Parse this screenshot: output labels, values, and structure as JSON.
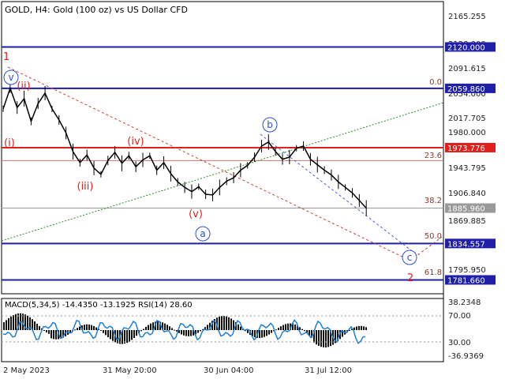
{
  "chart_data": [
    {
      "type": "line",
      "title": "GOLD, H4:  Gold (100 oz) vs US Dollar CFD",
      "y_range": [
        1760,
        2190
      ],
      "price_axis_ticks": [
        "2165.255",
        "2128.000",
        "2091.615",
        "2054.000",
        "2017.705",
        "1980.000",
        "1943.795",
        "1906.840",
        "1869.885",
        "1795.950"
      ],
      "x_ticks": [
        "2 May 2023",
        "31 May 20:00",
        "30 Jun 04:00",
        "31 Jul 12:00"
      ],
      "price_series_approx": [
        [
          0,
          2030
        ],
        [
          3,
          2060
        ],
        [
          6,
          2032
        ],
        [
          9,
          2045
        ],
        [
          12,
          2012
        ],
        [
          15,
          2038
        ],
        [
          18,
          2053
        ],
        [
          21,
          2030
        ],
        [
          24,
          2014
        ],
        [
          27,
          1995
        ],
        [
          30,
          1968
        ],
        [
          33,
          1952
        ],
        [
          36,
          1963
        ],
        [
          39,
          1944
        ],
        [
          42,
          1935
        ],
        [
          45,
          1955
        ],
        [
          48,
          1967
        ],
        [
          51,
          1951
        ],
        [
          54,
          1962
        ],
        [
          57,
          1946
        ],
        [
          60,
          1956
        ],
        [
          63,
          1962
        ],
        [
          66,
          1941
        ],
        [
          69,
          1952
        ],
        [
          72,
          1936
        ],
        [
          75,
          1924
        ],
        [
          78,
          1916
        ],
        [
          81,
          1910
        ],
        [
          84,
          1917
        ],
        [
          87,
          1906
        ],
        [
          90,
          1905
        ],
        [
          93,
          1916
        ],
        [
          96,
          1925
        ],
        [
          99,
          1930
        ],
        [
          102,
          1941
        ],
        [
          105,
          1948
        ],
        [
          108,
          1960
        ],
        [
          111,
          1976
        ],
        [
          114,
          1982
        ],
        [
          117,
          1968
        ],
        [
          120,
          1957
        ],
        [
          123,
          1960
        ],
        [
          126,
          1973
        ],
        [
          129,
          1976
        ],
        [
          132,
          1957
        ],
        [
          135,
          1949
        ],
        [
          138,
          1941
        ],
        [
          141,
          1934
        ],
        [
          144,
          1924
        ],
        [
          147,
          1916
        ],
        [
          150,
          1908
        ],
        [
          153,
          1897
        ],
        [
          156,
          1886
        ]
      ],
      "horizontal_levels": [
        {
          "label": "2120.000",
          "value": 2120.0,
          "color": "#1f1fa8"
        },
        {
          "label": "2059.860",
          "value": 2059.86,
          "color": "#1f1fa8"
        },
        {
          "label": "1973.776",
          "value": 1973.776,
          "color": "#e0201c"
        },
        {
          "label": "1885.960",
          "value": 1885.96,
          "color": "#9a9a9a"
        },
        {
          "label": "1834.557",
          "value": 1834.557,
          "color": "#1f1fa8"
        },
        {
          "label": "1781.660",
          "value": 1781.66,
          "color": "#1f1fa8"
        }
      ],
      "fibo_labels": [
        "0.0",
        "23.6",
        "38.2",
        "50.0",
        "61.8"
      ],
      "wave_labels": [
        "1",
        "2",
        "v",
        "(ii)",
        "(i)",
        "(iii)",
        "(iv)",
        "(v)",
        "a",
        "b",
        "c"
      ]
    },
    {
      "type": "bar",
      "title": "MACD(5,34,5) -14.4350 -13.1925 RSI(14) 28.60",
      "y_ticks": [
        "38.2348",
        "70.00",
        "30.00",
        "-36.9369"
      ]
    }
  ],
  "colors": {
    "level_blue": "#1f1fa8",
    "level_red": "#e0201c",
    "fibo_brown": "#8b3a2a",
    "ellipse_blue": "#2a4fd0",
    "macd_bar": "#111111",
    "rsi_line": "#1e7fd6"
  }
}
